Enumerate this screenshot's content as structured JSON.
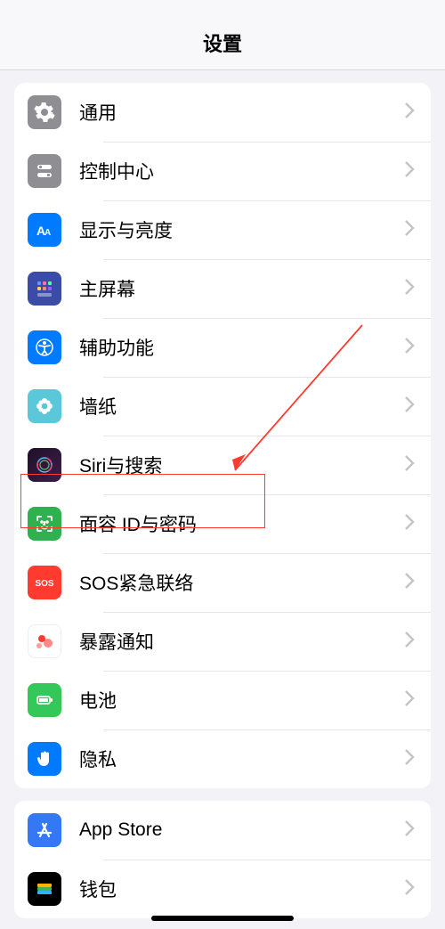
{
  "header": {
    "title": "设置"
  },
  "group1": {
    "rows": [
      {
        "label": "通用"
      },
      {
        "label": "控制中心"
      },
      {
        "label": "显示与亮度"
      },
      {
        "label": "主屏幕"
      },
      {
        "label": "辅助功能"
      },
      {
        "label": "墙纸"
      },
      {
        "label": "Siri与搜索"
      },
      {
        "label": "面容 ID与密码"
      },
      {
        "label": "SOS紧急联络"
      },
      {
        "label": "暴露通知"
      },
      {
        "label": "电池"
      },
      {
        "label": "隐私"
      }
    ]
  },
  "group2": {
    "rows": [
      {
        "label": "App Store"
      },
      {
        "label": "钱包"
      }
    ]
  }
}
